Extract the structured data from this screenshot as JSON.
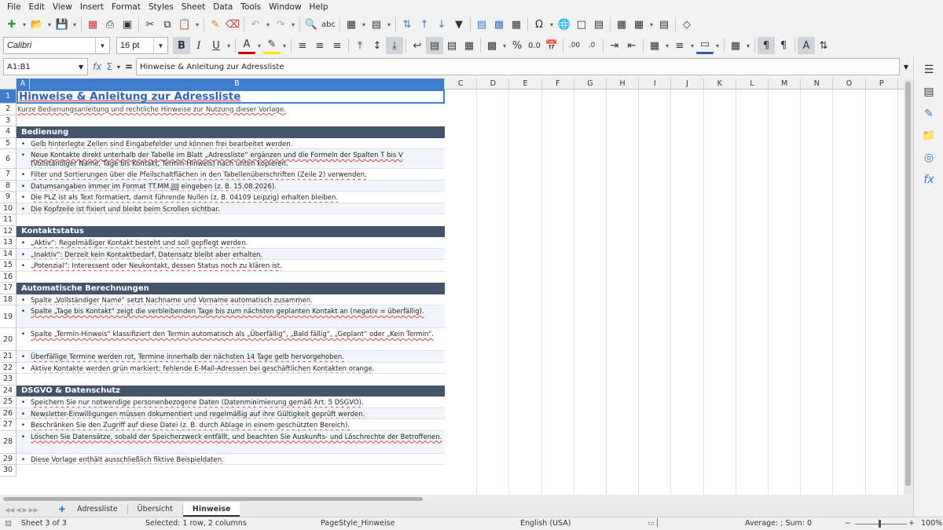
{
  "menu": [
    "File",
    "Edit",
    "View",
    "Insert",
    "Format",
    "Styles",
    "Sheet",
    "Data",
    "Tools",
    "Window",
    "Help"
  ],
  "format_bar": {
    "font_name": "Calibri",
    "font_size": "16 pt"
  },
  "formula_bar": {
    "cell_ref": "A1:B1",
    "content": "Hinweise & Anleitung zur Adressliste"
  },
  "columns": [
    "A",
    "B",
    "C",
    "D",
    "E",
    "F",
    "G",
    "H",
    "I",
    "J",
    "K",
    "L",
    "M",
    "N",
    "O",
    "P"
  ],
  "selected_columns": [
    "A",
    "B"
  ],
  "selected_row": 1,
  "rows": [
    {
      "n": 1,
      "type": "title",
      "text": "Hinweise & Anleitung zur Adressliste"
    },
    {
      "n": 2,
      "type": "note",
      "text": "Kurze Bedienungsanleitung und rechtliche Hinweise zur Nutzung dieser Vorlage."
    },
    {
      "n": 3,
      "type": "empty",
      "text": ""
    },
    {
      "n": 4,
      "type": "section",
      "text": "Bedienung"
    },
    {
      "n": 5,
      "type": "bullet",
      "text": "Gelb hinterlegte Zellen sind Eingabefelder und können frei bearbeitet werden."
    },
    {
      "n": 6,
      "type": "bullet",
      "text": "Neue Kontakte direkt unterhalb der Tabelle im Blatt „Adressliste“ ergänzen und die Formeln der Spalten T bis V (Vollständiger Name, Tage bis Kontakt, Termin-Hinweis) nach unten kopieren."
    },
    {
      "n": 7,
      "type": "bullet",
      "text": "Filter und Sortierungen über die Pfeilschaltflächen in den Tabellenüberschriften (Zeile 2) verwenden."
    },
    {
      "n": 8,
      "type": "bullet",
      "text": "Datumsangaben immer im Format TT.MM.JJJJ eingeben (z. B. 15.08.2026)."
    },
    {
      "n": 9,
      "type": "bullet",
      "text": "Die PLZ ist als Text formatiert, damit führende Nullen (z. B. 04109 Leipzig) erhalten bleiben."
    },
    {
      "n": 10,
      "type": "bullet",
      "text": "Die Kopfzeile ist fixiert und bleibt beim Scrollen sichtbar."
    },
    {
      "n": 11,
      "type": "empty",
      "text": ""
    },
    {
      "n": 12,
      "type": "section",
      "text": "Kontaktstatus"
    },
    {
      "n": 13,
      "type": "bullet",
      "text": "„Aktiv“: Regelmäßiger Kontakt besteht und soll gepflegt werden."
    },
    {
      "n": 14,
      "type": "bullet",
      "text": "„Inaktiv“: Derzeit kein Kontaktbedarf, Datensatz bleibt aber erhalten."
    },
    {
      "n": 15,
      "type": "bullet",
      "text": "„Potenzial“: Interessent oder Neukontakt, dessen Status noch zu klären ist."
    },
    {
      "n": 16,
      "type": "empty",
      "text": ""
    },
    {
      "n": 17,
      "type": "section",
      "text": "Automatische Berechnungen"
    },
    {
      "n": 18,
      "type": "bullet",
      "text": "Spalte „Vollständiger Name“ setzt Nachname und Vorname automatisch zusammen."
    },
    {
      "n": 19,
      "type": "bullet",
      "text": "Spalte „Tage bis Kontakt“ zeigt die verbleibenden Tage bis zum nächsten geplanten Kontakt an (negativ = überfällig)."
    },
    {
      "n": 20,
      "type": "bullet",
      "text": "Spalte „Termin-Hinweis“ klassifiziert den Termin automatisch als „Überfällig“, „Bald fällig“, „Geplant“ oder „Kein Termin“."
    },
    {
      "n": 21,
      "type": "bullet",
      "text": "Überfällige Termine werden rot, Termine innerhalb der nächsten 14 Tage gelb hervorgehoben."
    },
    {
      "n": 22,
      "type": "bullet",
      "text": "Aktive Kontakte werden grün markiert; fehlende E-Mail-Adressen bei geschäftlichen Kontakten orange."
    },
    {
      "n": 23,
      "type": "empty",
      "text": ""
    },
    {
      "n": 24,
      "type": "section",
      "text": "DSGVO & Datenschutz"
    },
    {
      "n": 25,
      "type": "bullet",
      "text": "Speichern Sie nur notwendige personenbezogene Daten (Datenminimierung gemäß Art. 5 DSGVO)."
    },
    {
      "n": 26,
      "type": "bullet",
      "text": "Newsletter-Einwilligungen müssen dokumentiert und regelmäßig auf ihre Gültigkeit geprüft werden."
    },
    {
      "n": 27,
      "type": "bullet",
      "text": "Beschränken Sie den Zugriff auf diese Datei (z. B. durch Ablage in einem geschützten Bereich)."
    },
    {
      "n": 28,
      "type": "bullet",
      "text": "Löschen Sie Datensätze, sobald der Speicherzweck entfällt, und beachten Sie Auskunfts- und Löschrechte der Betroffenen."
    },
    {
      "n": 29,
      "type": "bullet",
      "text": "Diese Vorlage enthält ausschließlich fiktive Beispieldaten."
    },
    {
      "n": 30,
      "type": "empty",
      "text": ""
    }
  ],
  "sheet_tabs": [
    {
      "label": "Adressliste",
      "active": false
    },
    {
      "label": "Übersicht",
      "active": false
    },
    {
      "label": "Hinweise",
      "active": true
    }
  ],
  "status": {
    "sheet": "Sheet 3 of 3",
    "selection": "Selected: 1 row, 2 columns",
    "page_style": "PageStyle_Hinweise",
    "language": "English (USA)",
    "sum": "Average: ; Sum: 0",
    "zoom": "100%"
  },
  "colors": {
    "section_bg": "#44546a",
    "selection": "#3f7ecf",
    "title": "#2f5fb8",
    "alt_row": "#f1f4f8"
  }
}
